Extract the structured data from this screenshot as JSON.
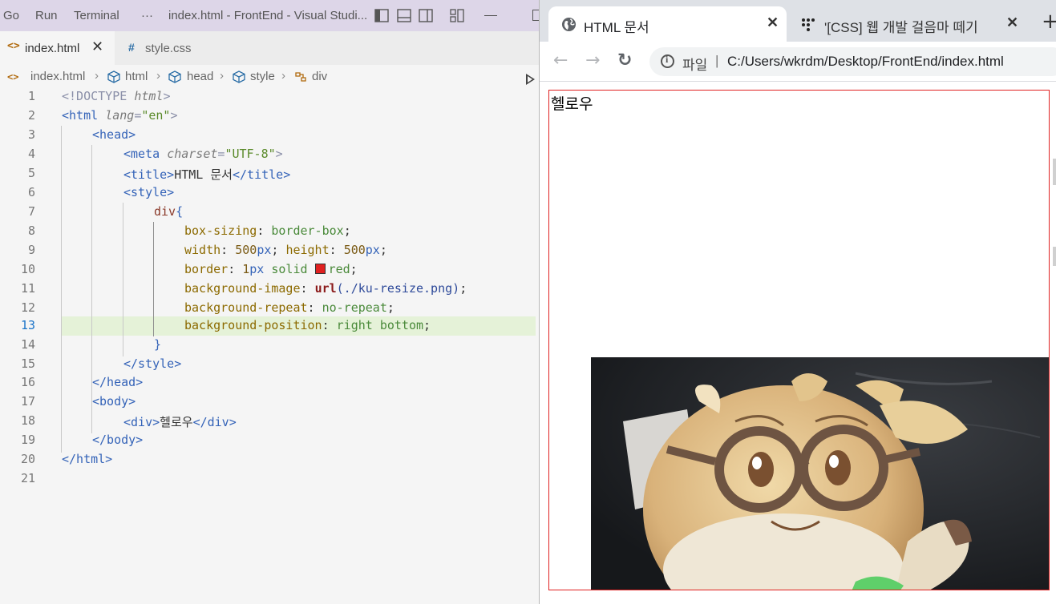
{
  "vscode": {
    "menu": [
      "Go",
      "Run",
      "Terminal",
      "···"
    ],
    "window_title": "index.html - FrontEnd - Visual Studi...",
    "tabs": [
      {
        "icon": "<>",
        "label": "index.html",
        "close": "✕"
      },
      {
        "icon": "#",
        "label": "style.css"
      }
    ],
    "breadcrumb": [
      "index.html",
      "html",
      "head",
      "style",
      "div"
    ],
    "line_numbers": [
      "1",
      "2",
      "3",
      "4",
      "5",
      "6",
      "7",
      "8",
      "9",
      "10",
      "11",
      "12",
      "13",
      "14",
      "15",
      "16",
      "17",
      "18",
      "19",
      "20",
      "21"
    ],
    "code": {
      "l1_doctype": "<!DOCTYPE",
      "l1_html": "html",
      "l1_close": ">",
      "l2_open": "<html",
      "l2_attr": "lang",
      "l2_eq": "=",
      "l2_val": "\"en\"",
      "l2_close": ">",
      "l3": "<head>",
      "l4_open": "<meta",
      "l4_attr": "charset",
      "l4_eq": "=",
      "l4_val": "\"UTF-8\"",
      "l4_close": ">",
      "l5_open": "<title>",
      "l5_text": "HTML 문서",
      "l5_close": "</title>",
      "l6": "<style>",
      "l7_sel": "div",
      "l7_brace": "{",
      "l8_prop": "box-sizing",
      "l8_val": "border-box",
      "l9_prop1": "width",
      "l9_num1": "500",
      "l9_unit1": "px",
      "l9_prop2": "height",
      "l9_num2": "500",
      "l9_unit2": "px",
      "l10_prop": "border",
      "l10_num": "1",
      "l10_unit": "px",
      "l10_val": "solid",
      "l10_color": "red",
      "l11_prop": "background-image",
      "l11_fn": "url",
      "l11_url": "(./ku-resize.png)",
      "l12_prop": "background-repeat",
      "l12_val": "no-repeat",
      "l13_prop": "background-position",
      "l13_val": "right bottom",
      "l14": "}",
      "l15": "</style>",
      "l16": "</head>",
      "l17": "<body>",
      "l18_open": "<div>",
      "l18_text": "헬로우",
      "l18_close": "</div>",
      "l19": "</body>",
      "l20": "</html>",
      "colon": ":",
      "semi": ";"
    },
    "active_line": "13",
    "swatch_color": "#e02020"
  },
  "browser": {
    "tabs": [
      {
        "title": "HTML 문서",
        "close": "✕",
        "icon": "globe-icon"
      },
      {
        "title": "'[CSS] 웹 개발 걸음마 떼기",
        "close": "✕",
        "icon": "site-dots-icon"
      }
    ],
    "new_tab": "+",
    "nav": {
      "back": "←",
      "forward": "→",
      "reload": "↻"
    },
    "address": {
      "scheme_label": "파일",
      "separator": "|",
      "url": "C:/Users/wkrdm/Desktop/FrontEnd/index.html"
    },
    "page": {
      "div_text": "헬로우",
      "border_color": "#e02020"
    }
  }
}
